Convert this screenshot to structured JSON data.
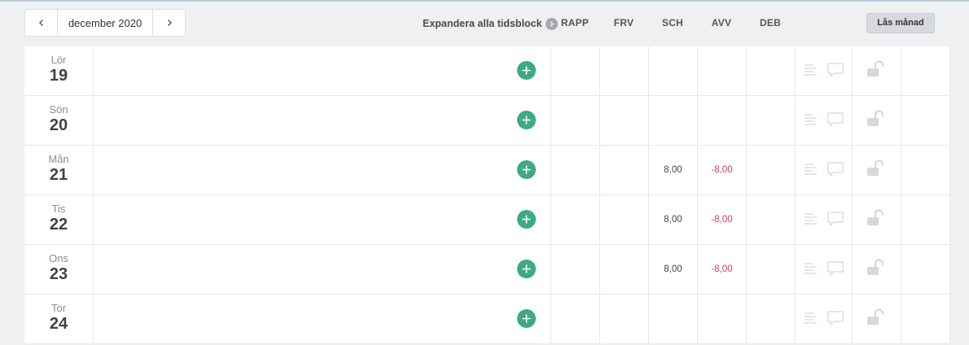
{
  "header": {
    "month_label": "december 2020",
    "expand_all_label": "Expandera alla tidsblock",
    "lock_month_label": "Lås månad",
    "columns": [
      "RAPP",
      "FRV",
      "SCH",
      "AVV",
      "DEB"
    ]
  },
  "colors": {
    "add": "#3daa83",
    "negative": "#d33a6a",
    "icon_muted": "#dcdee1"
  },
  "icons": {
    "prev": "chevron-left-icon",
    "next": "chevron-right-icon",
    "expand": "chevron-right-circle-icon",
    "add": "plus-circle-icon",
    "notes": "lines-icon",
    "comment": "comment-bubble-icon",
    "lock": "unlocked-padlock-icon"
  },
  "rows": [
    {
      "day": "Lör",
      "date": "19",
      "rapp": "",
      "frv": "",
      "sch": "",
      "avv": "",
      "deb": ""
    },
    {
      "day": "Sön",
      "date": "20",
      "rapp": "",
      "frv": "",
      "sch": "",
      "avv": "",
      "deb": ""
    },
    {
      "day": "Mån",
      "date": "21",
      "rapp": "",
      "frv": "",
      "sch": "8,00",
      "avv": "-8,00",
      "deb": ""
    },
    {
      "day": "Tis",
      "date": "22",
      "rapp": "",
      "frv": "",
      "sch": "8,00",
      "avv": "-8,00",
      "deb": ""
    },
    {
      "day": "Ons",
      "date": "23",
      "rapp": "",
      "frv": "",
      "sch": "8,00",
      "avv": "-8,00",
      "deb": ""
    },
    {
      "day": "Tor",
      "date": "24",
      "rapp": "",
      "frv": "",
      "sch": "",
      "avv": "",
      "deb": ""
    }
  ]
}
